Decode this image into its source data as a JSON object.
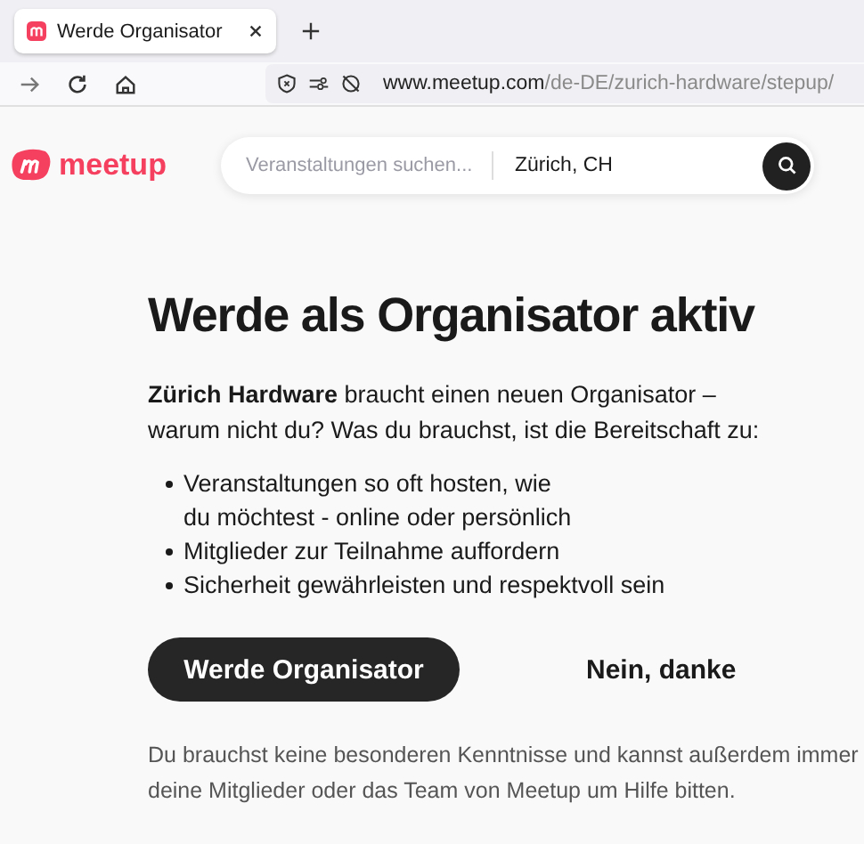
{
  "browser": {
    "tab": {
      "title": "Werde Organisator",
      "selected": true
    },
    "url": {
      "host": "www.meetup.com",
      "path": "/de-DE/zurich-hardware/stepup/"
    }
  },
  "header": {
    "logo": "meetup",
    "search": {
      "placeholder": "Veranstaltungen suchen...",
      "location": "Zürich, CH"
    }
  },
  "main": {
    "title": "Werde als Organisator aktiv",
    "intro": "**Zürich Hardware** braucht einen neuen Organisator –\nwarum nicht du? Was du brauchst, ist die Bereitschaft zu:",
    "bullets": [
      "Veranstaltungen so oft hosten, wie\ndu möchtest - online oder persönlich",
      "Mitglieder zur Teilnahme auffordern",
      "Sicherheit gewährleisten und respektvoll sein"
    ],
    "primary_button": "Werde Organisator",
    "secondary_button": "Nein, danke",
    "footnote": "Du brauchst keine besonderen Kenntnisse und kannst außerdem immer deine Mitglieder oder das Team von Meetup um Hilfe bitten."
  }
}
